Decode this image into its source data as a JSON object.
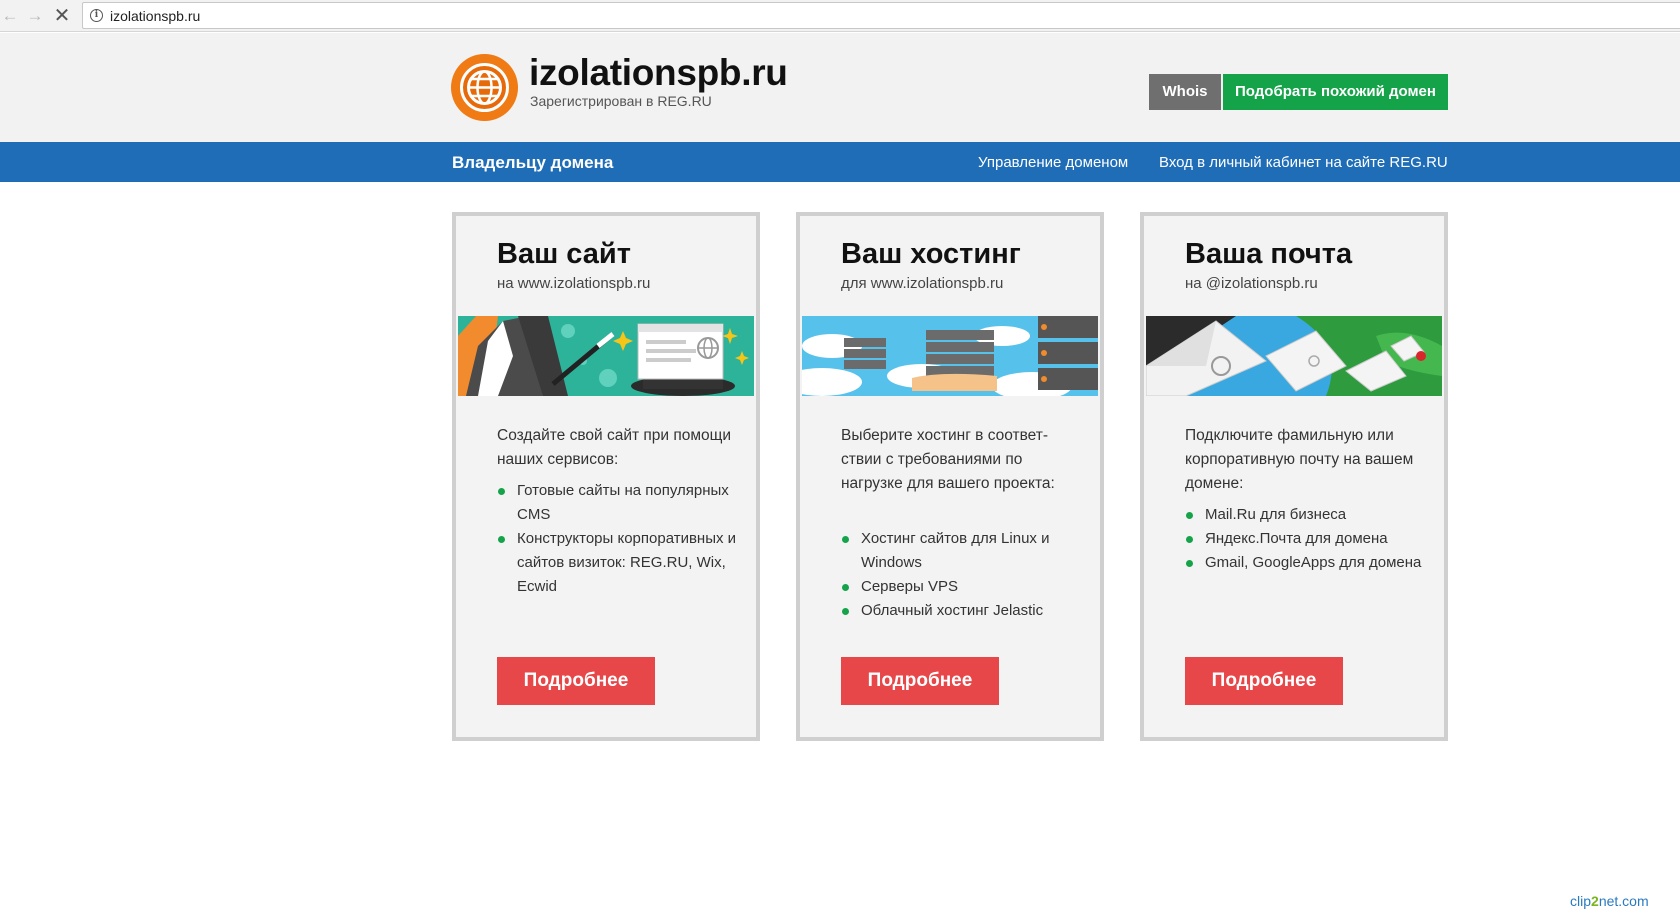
{
  "browser": {
    "url": "izolationspb.ru"
  },
  "header": {
    "title": "izolationspb.ru",
    "subtitle": "Зарегистрирован в REG.RU",
    "whois_label": "Whois",
    "similar_label": "Подобрать похожий домен"
  },
  "bar": {
    "title": "Владельцу домена",
    "link_manage": "Управление доменом",
    "link_cabinet": "Вход в личный кабинет на сайте REG.RU"
  },
  "cards": [
    {
      "title": "Ваш сайт",
      "subtitle": "на www.izolationspb.ru",
      "description": "Создайте свой сайт при помощи наших сервисов:",
      "items": [
        "Готовые сайты на популярных CMS",
        "Конструкторы корпоративных и сайтов визиток: REG.RU, Wix, Ecwid"
      ],
      "button": "Подробнее"
    },
    {
      "title": "Ваш хостинг",
      "subtitle": "для www.izolationspb.ru",
      "description": "Выберите хостинг в соответ- ствии с требованиями по нагрузке для вашего проекта:",
      "items": [
        "Хостинг сайтов для Linux и Windows",
        "Серверы VPS",
        "Облачный хостинг Jelastic"
      ],
      "button": "Подробнее"
    },
    {
      "title": "Ваша почта",
      "subtitle": "на @izolationspb.ru",
      "description": "Подключите фамильную или корпоративную почту на вашем домене:",
      "items": [
        "Mail.Ru для бизнеса",
        "Яндекс.Почта для домена",
        "Gmail, GoogleApps для домена"
      ],
      "button": "Подробнее"
    }
  ],
  "watermark": {
    "prefix": "clip",
    "middle": "2",
    "suffix": "net.com"
  },
  "colors": {
    "accent_blue": "#1f6db6",
    "green": "#15a34a",
    "red": "#e8474a",
    "orange": "#f07a14"
  }
}
